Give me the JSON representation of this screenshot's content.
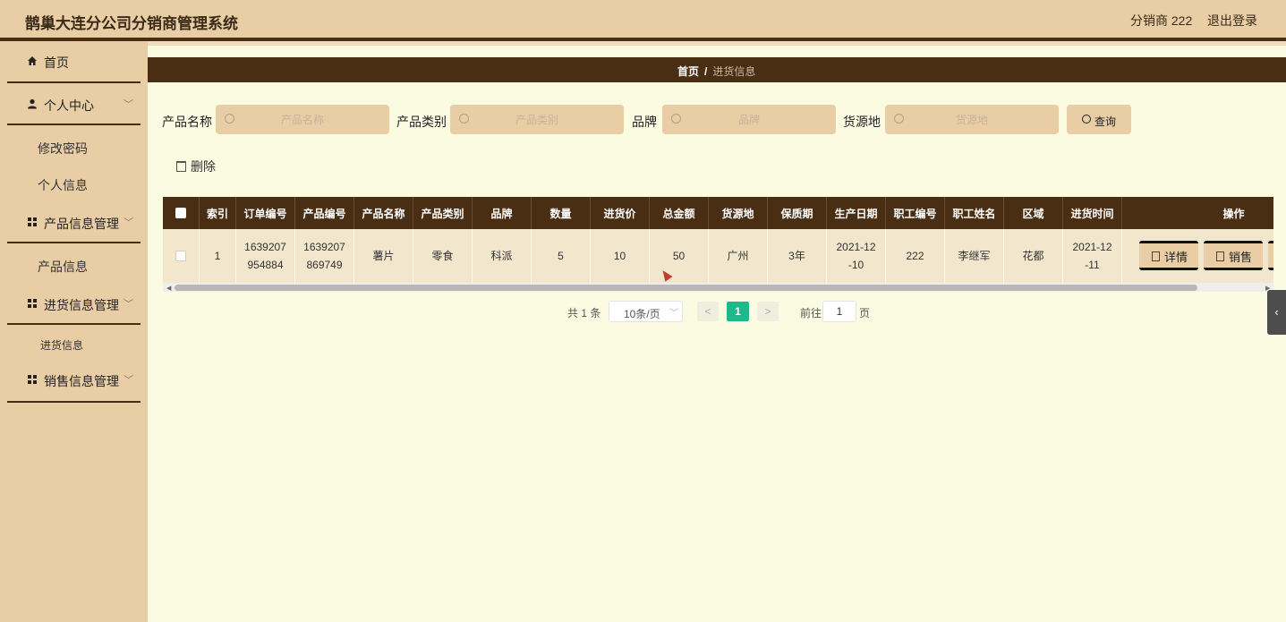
{
  "header": {
    "title": "鹊巢大连分公司分销商管理系统",
    "user": "分销商 222",
    "logout": "退出登录"
  },
  "sidebar": {
    "home": "首页",
    "personal_center": "个人中心",
    "change_password": "修改密码",
    "personal_info": "个人信息",
    "product_mgmt": "产品信息管理",
    "product_info": "产品信息",
    "purchase_mgmt": "进货信息管理",
    "purchase_info": "进货信息",
    "sales_mgmt": "销售信息管理"
  },
  "breadcrumb": {
    "home": "首页",
    "sep": "/",
    "current": "进货信息"
  },
  "search": {
    "product_name_label": "产品名称",
    "product_name_placeholder": "产品名称",
    "category_label": "产品类别",
    "category_placeholder": "产品类别",
    "brand_label": "品牌",
    "brand_placeholder": "品牌",
    "origin_label": "货源地",
    "origin_placeholder": "货源地",
    "query_button": "查询"
  },
  "toolbar": {
    "delete": "删除"
  },
  "table": {
    "columns": [
      "索引",
      "订单编号",
      "产品编号",
      "产品名称",
      "产品类别",
      "品牌",
      "数量",
      "进货价",
      "总金额",
      "货源地",
      "保质期",
      "生产日期",
      "职工编号",
      "职工姓名",
      "区域",
      "进货时间",
      "操作"
    ],
    "rows": [
      {
        "index": "1",
        "order_no": "1639207954884",
        "product_no": "1639207869749",
        "product_name": "薯片",
        "category": "零食",
        "brand": "科派",
        "quantity": "5",
        "price": "10",
        "total": "50",
        "origin": "广州",
        "shelf_life": "3年",
        "production_date": "2021-12-10",
        "staff_no": "222",
        "staff_name": "李继军",
        "area": "花都",
        "purchase_time": "2021-12-11",
        "actions": [
          "详情",
          "销售"
        ]
      }
    ]
  },
  "pagination": {
    "total": "共 1 条",
    "page_size": "10条/页",
    "prev": "<",
    "current": "1",
    "next": ">",
    "goto_label": "前往",
    "goto_value": "1",
    "goto_unit": "页"
  },
  "side_toggle": "‹"
}
